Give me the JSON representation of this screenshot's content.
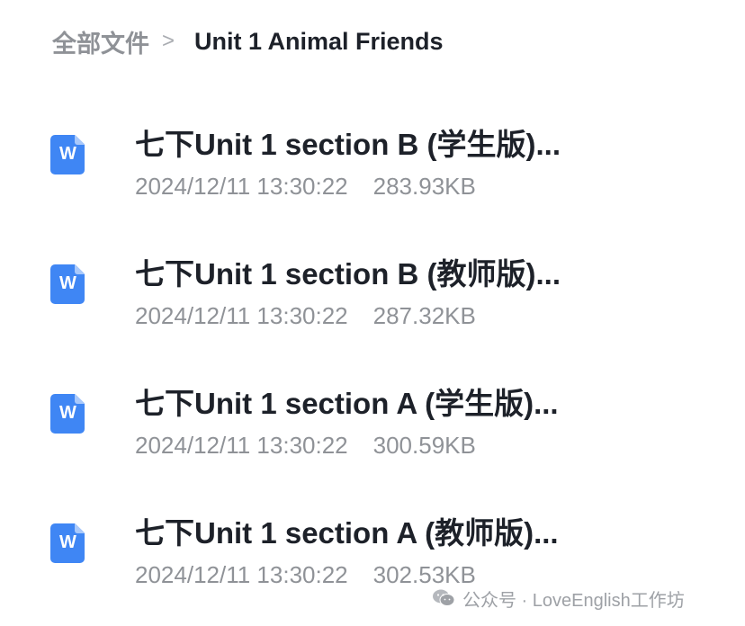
{
  "breadcrumb": {
    "root": "全部文件",
    "separator": ">",
    "current": "Unit 1 Animal Friends"
  },
  "files": [
    {
      "icon": "word-doc-icon",
      "name": "七下Unit 1 section B (学生版)...",
      "date": "2024/12/11 13:30:22",
      "size": "283.93KB"
    },
    {
      "icon": "word-doc-icon",
      "name": "七下Unit 1 section B (教师版)...",
      "date": "2024/12/11 13:30:22",
      "size": "287.32KB"
    },
    {
      "icon": "word-doc-icon",
      "name": "七下Unit 1 section A (学生版)...",
      "date": "2024/12/11 13:30:22",
      "size": "300.59KB"
    },
    {
      "icon": "word-doc-icon",
      "name": "七下Unit 1 section A (教师版)...",
      "date": "2024/12/11 13:30:22",
      "size": "302.53KB"
    }
  ],
  "file_icon_letter": "W",
  "watermark": "公众号 · LoveEnglish工作坊",
  "colors": {
    "icon_blue": "#3f86f4",
    "text_dark": "#1d2129",
    "text_gray": "#8f9297"
  }
}
